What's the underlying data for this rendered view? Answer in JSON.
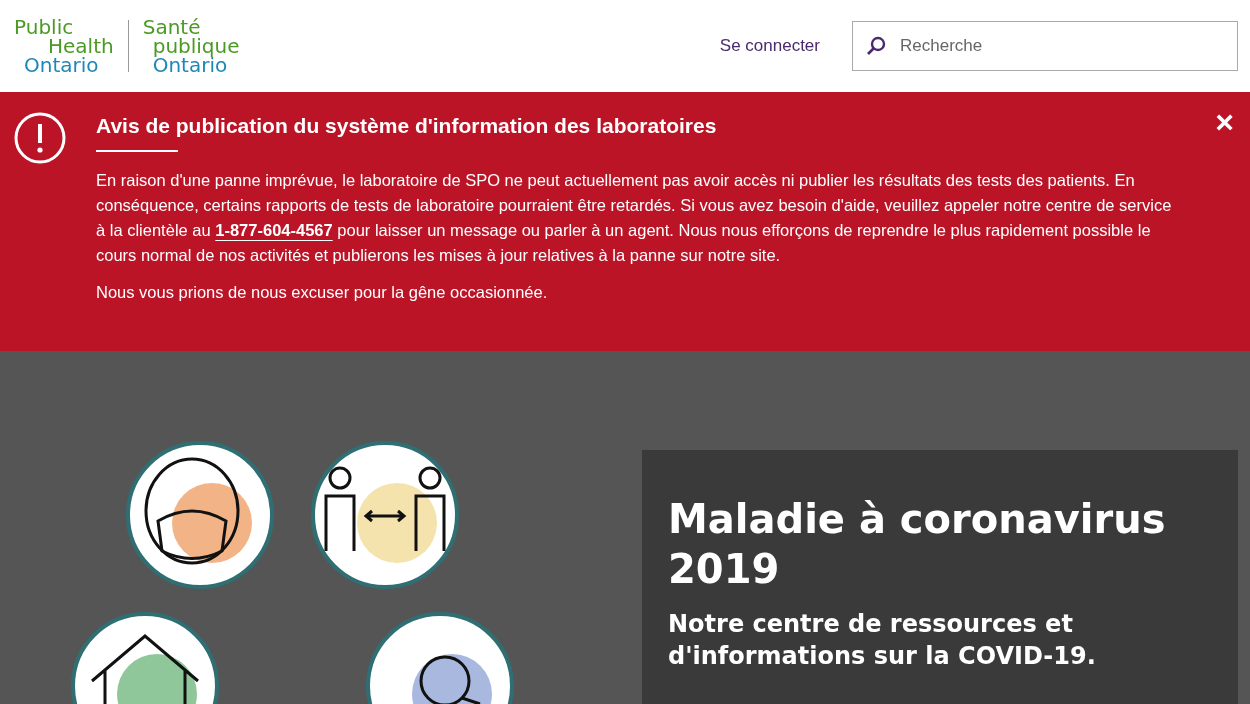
{
  "header": {
    "logo_english": [
      "Public",
      "Health",
      "Ontario"
    ],
    "logo_french": [
      "Santé",
      "publique",
      "Ontario"
    ],
    "login_link": "Se connecter",
    "search": {
      "placeholder": "Recherche"
    }
  },
  "alert": {
    "title": "Avis de publication du système d'information des laboratoires",
    "paragraph_before_link": "En raison d'une panne imprévue, le laboratoire de SPO ne peut actuellement pas avoir accès ni publier les résultats des tests des patients. En conséquence, certains rapports de tests de laboratoire pourraient être retardés. Si vous avez besoin d'aide, veuillez appeler notre centre de service à la clientèle au",
    "phone_link": "1-877-604-4567",
    "paragraph_after_link": "pour laisser un message ou parler à un agent. Nous nous efforçons de reprendre le plus rapidement possible le cours normal de nos activités et publierons les mises à jour relatives à la panne sur notre site.",
    "apology": "Nous vous prions de nous excuser pour la gêne occasionnée.",
    "close": "×"
  },
  "hero": {
    "title": "Maladie à coronavirus 2019",
    "subtitle": "Notre centre de ressources et d'informations sur la COVID-19."
  }
}
